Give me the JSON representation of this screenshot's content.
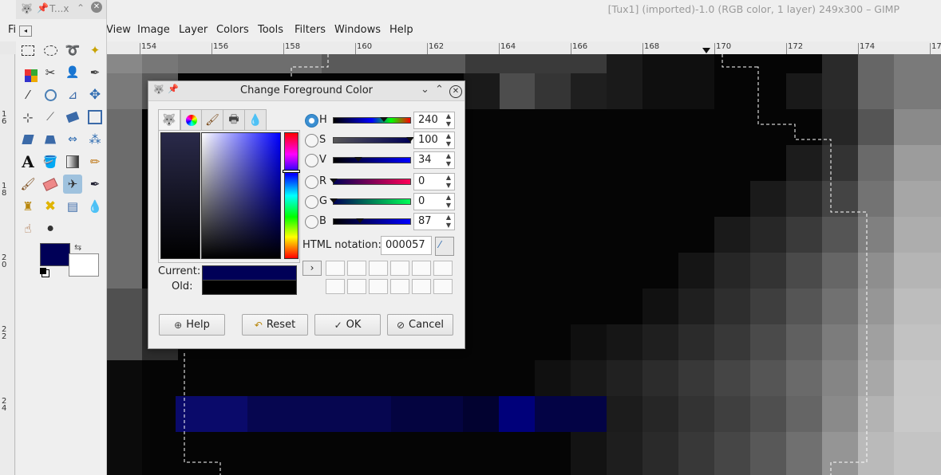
{
  "window": {
    "title": "[Tux1] (imported)-1.0 (RGB color, 1 layer) 249x300 – GIMP"
  },
  "toolbox": {
    "title": "T...x"
  },
  "menubar": {
    "items": [
      "Fi",
      "View",
      "Image",
      "Layer",
      "Colors",
      "Tools",
      "Filters",
      "Windows",
      "Help"
    ]
  },
  "ruler": {
    "h_labels": [
      "154",
      "156",
      "158",
      "160",
      "162",
      "164",
      "166",
      "168",
      "170",
      "172",
      "174",
      "17"
    ],
    "v_labels": [
      "1\n6",
      "1\n8",
      "2\n0",
      "2\n2",
      "2\n4"
    ]
  },
  "dialog": {
    "title": "Change Foreground Color",
    "channels": [
      {
        "label": "H",
        "value": "240",
        "level": 0.67,
        "selected": true
      },
      {
        "label": "S",
        "value": "100",
        "level": 1.0,
        "selected": false
      },
      {
        "label": "V",
        "value": "34",
        "level": 0.34,
        "selected": false
      },
      {
        "label": "R",
        "value": "0",
        "level": 0.0,
        "selected": false
      },
      {
        "label": "G",
        "value": "0",
        "level": 0.0,
        "selected": false
      },
      {
        "label": "B",
        "value": "87",
        "level": 0.34,
        "selected": false
      }
    ],
    "html_notation_label": "HTML notation:",
    "html_notation_value": "000057",
    "current_label": "Current:",
    "old_label": "Old:",
    "current_color": "#000057",
    "old_color": "#000000",
    "buttons": {
      "help": "Help",
      "reset": "Reset",
      "ok": "OK",
      "cancel": "Cancel"
    }
  },
  "colors": {
    "foreground": "#000057",
    "background": "#ffffff",
    "selection_highlight": "#9fc2de"
  }
}
